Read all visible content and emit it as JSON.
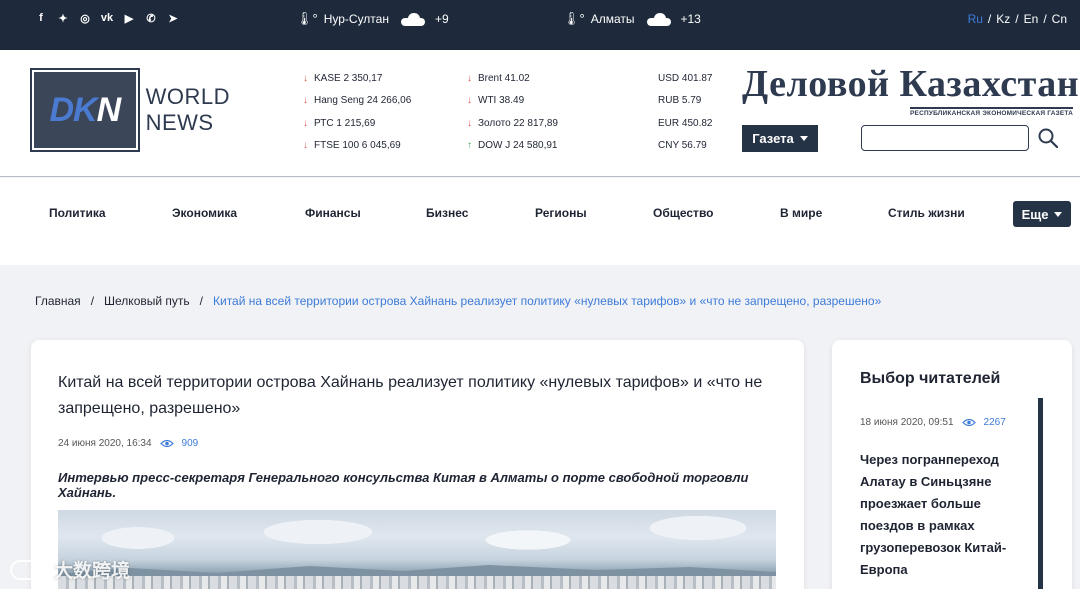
{
  "topbar": {
    "social_icons": [
      "facebook-icon",
      "twitter-icon",
      "instagram-icon",
      "vk-icon",
      "youtube-icon",
      "whatsapp-icon",
      "telegram-icon"
    ],
    "weather": [
      {
        "city": "Нур-Султан",
        "temp": "+9"
      },
      {
        "city": "Алматы",
        "temp": "+13"
      }
    ],
    "languages": [
      "Ru",
      "Kz",
      "En",
      "Cn"
    ],
    "active_language": "Ru"
  },
  "header": {
    "logo": {
      "mark_d": "DK",
      "mark_n": "N",
      "line1": "WORLD",
      "line2": "NEWS"
    },
    "quotes_col1": [
      "KASE 2 350,17",
      "Hang Seng 24 266,06",
      "РТС 1 215,69",
      "FTSE 100 6 045,69"
    ],
    "quotes_col2": [
      "Brent 41.02",
      "WTI 38.49",
      "Золото 22 817,89",
      "DOW J 24 580,91"
    ],
    "quotes_col2_trend": [
      "down",
      "down",
      "down",
      "up"
    ],
    "quotes_col3": [
      "USD 401.87",
      "RUB 5.79",
      "EUR 450.82",
      "CNY 56.79"
    ],
    "masthead_title": "Деловой Казахстан",
    "masthead_subtitle": "РЕСПУБЛИКАНСКАЯ ЭКОНОМИЧЕСКАЯ ГАЗЕТА",
    "paper_button": "Газета",
    "search_placeholder": ""
  },
  "nav": {
    "items": [
      "Политика",
      "Экономика",
      "Финансы",
      "Бизнес",
      "Регионы",
      "Общество",
      "В мире",
      "Стиль жизни"
    ],
    "more": "Еще"
  },
  "breadcrumb": {
    "home": "Главная",
    "section": "Шелковый путь",
    "current": "Китай на всей территории острова Хайнань реализует политику «нулевых тарифов» и «что не запрещено, разрешено»",
    "separator": "/"
  },
  "article": {
    "title": "Китай на всей территории острова Хайнань реализует политику «нулевых тарифов» и «что не запрещено, разрешено»",
    "date": "24 июня 2020, 16:34",
    "views": "909",
    "lead": "Интервью пресс-секретаря Генерального консульства Китая в Алматы о порте свободной торговли Хайнань."
  },
  "sidebar": {
    "title": "Выбор читателей",
    "date": "18 июня 2020, 09:51",
    "views": "2267",
    "headline": "Через погранпереход Алатау в Синьцзяне проезжает больше поездов в рамках грузоперевозок Китай-Европа"
  },
  "watermark": {
    "text": "大数跨境"
  },
  "colors": {
    "topbar": "#1e2a3b",
    "accent": "#3d7bd8",
    "button": "#253347"
  }
}
